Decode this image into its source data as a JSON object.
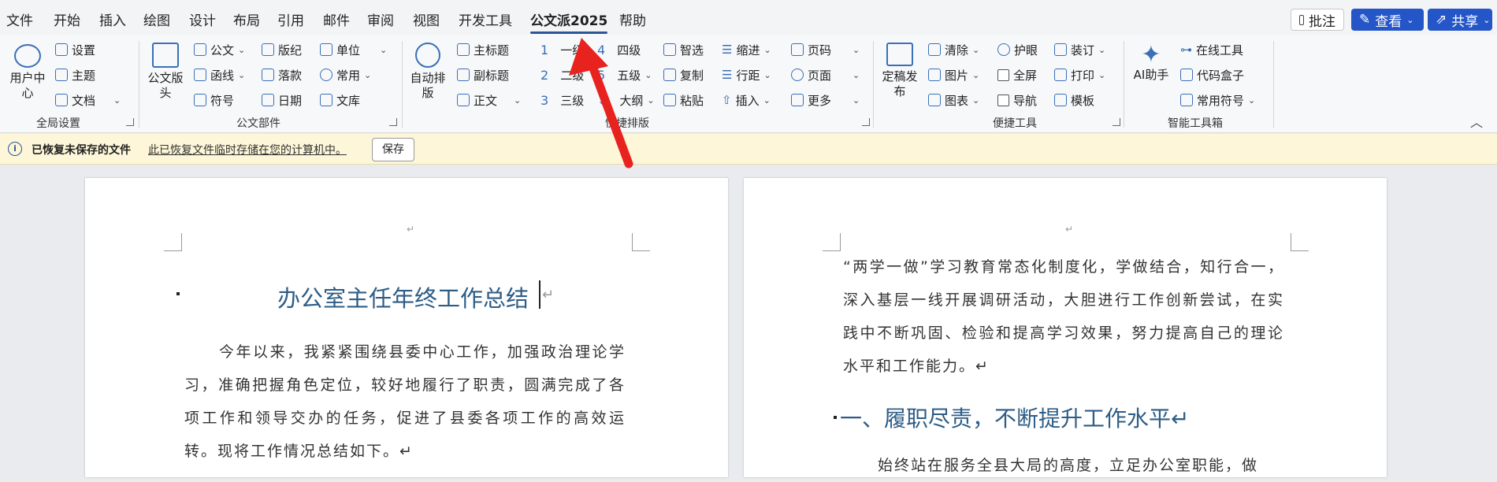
{
  "menu": {
    "items": [
      "文件",
      "开始",
      "插入",
      "绘图",
      "设计",
      "布局",
      "引用",
      "邮件",
      "审阅",
      "视图",
      "开发工具",
      "公文派2025",
      "帮助"
    ],
    "active": "公文派2025",
    "comment_button": "批注",
    "view_button": "查看",
    "share_button": "共享"
  },
  "ribbon": {
    "global": {
      "user_center": "用户中心",
      "settings": "设置",
      "theme": "主题",
      "doc": "文档",
      "label": "全局设置"
    },
    "parts": {
      "header": "公文版头",
      "official": "公文",
      "letter": "函线",
      "symbol": "符号",
      "layout": "版纪",
      "sign": "落款",
      "date": "日期",
      "unit": "单位",
      "common": "常用",
      "library": "文库",
      "label": "公文部件"
    },
    "format": {
      "auto": "自动排版",
      "main_title": "主标题",
      "sub_title": "副标题",
      "body": "正文",
      "level1": "一级",
      "level2": "二级",
      "level3": "三级",
      "level4": "四级",
      "level5": "五级",
      "outline": "大纲",
      "smart": "智选",
      "copy": "复制",
      "paste": "粘贴",
      "indent": "缩进",
      "line_spacing": "行距",
      "insert": "插入",
      "page_num": "页码",
      "page": "页面",
      "more": "更多",
      "label": "快捷排版"
    },
    "tools": {
      "publish": "定稿发布",
      "clear": "清除",
      "image": "图片",
      "chart": "图表",
      "eye": "护眼",
      "fullscreen": "全屏",
      "nav": "导航",
      "binding": "装订",
      "print": "打印",
      "template": "模板",
      "label": "便捷工具"
    },
    "smart": {
      "ai": "AI助手",
      "online": "在线工具",
      "code": "代码盒子",
      "symbols": "常用符号",
      "label": "智能工具箱"
    }
  },
  "notification": {
    "title": "已恢复未保存的文件",
    "message": "此已恢复文件临时存储在您的计算机中。",
    "save": "保存"
  },
  "doc": {
    "page_mark": "↵",
    "title": "办公室主任年终工作总结",
    "para_mark": "↵",
    "left_para": "今年以来，我紧紧围绕县委中心工作，加强政治理论学习，准确把握角色定位，较好地履行了职责，圆满完成了各项工作和领导交办的任务，促进了县委各项工作的高效运转。现将工作情况总结如下。↵",
    "right_para1": "“两学一做”学习教育常态化制度化，学做结合，知行合一，深入基层一线开展调研活动，大胆进行工作创新尝试，在实践中不断巩固、检验和提高学习效果，努力提高自己的理论水平和工作能力。↵",
    "right_heading": "一、履职尽责，不断提升工作水平↵",
    "right_para2": "始终站在服务全县大局的高度，立足办公室职能，做"
  },
  "colors": {
    "accent": "#2456c7",
    "arrow": "#e8231f",
    "heading": "#2e5d86",
    "notification": "#fdf6d8"
  }
}
